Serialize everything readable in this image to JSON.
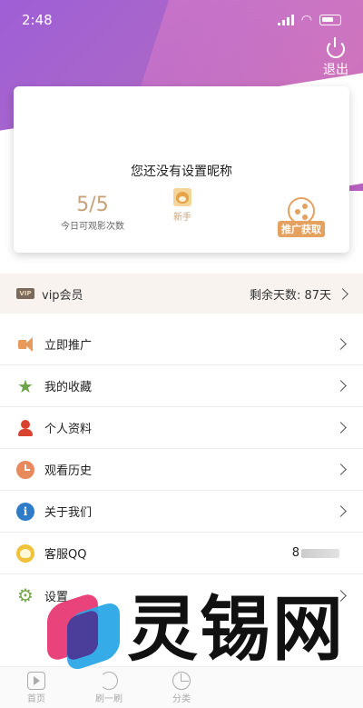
{
  "status_bar": {
    "time": "2:48"
  },
  "header": {
    "logout_label": "退出"
  },
  "profile": {
    "nickname": "您还没有设置昵称",
    "views_count": "5/5",
    "views_label": "今日可观影次数",
    "level_label": "新手",
    "promo_label": "推广获取"
  },
  "vip": {
    "badge": "VIP",
    "label": "vip会员",
    "remaining_days": "剩余天数: 87天"
  },
  "menu": {
    "items": [
      {
        "label": "立即推广",
        "icon": "megaphone-icon"
      },
      {
        "label": "我的收藏",
        "icon": "star-icon"
      },
      {
        "label": "个人资料",
        "icon": "person-icon"
      },
      {
        "label": "观看历史",
        "icon": "clock-icon"
      },
      {
        "label": "关于我们",
        "icon": "info-icon"
      },
      {
        "label": "客服QQ",
        "icon": "headset-icon",
        "value": "8"
      },
      {
        "label": "设置",
        "icon": "gear-icon"
      }
    ]
  },
  "tabbar": {
    "tabs": [
      {
        "label": "首页",
        "icon": "play-icon"
      },
      {
        "label": "刷一刷",
        "icon": "refresh-icon"
      },
      {
        "label": "分类",
        "icon": "pie-icon"
      }
    ]
  },
  "watermark": {
    "text": "灵锡网"
  },
  "colors": {
    "header_purple": "#a966c9",
    "gold": "#c8a277",
    "promo_orange": "#e4a15f"
  }
}
